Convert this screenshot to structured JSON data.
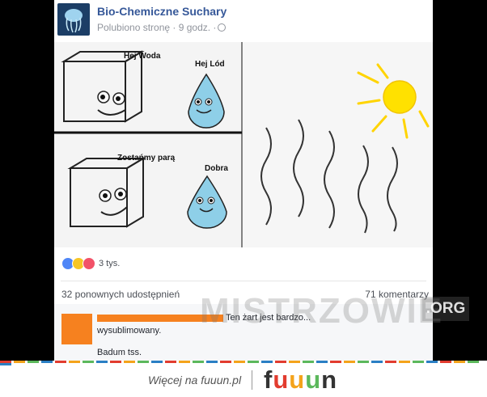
{
  "post": {
    "page_name": "Bio-Chemiczne Suchary",
    "meta": "Polubiono stronę · 9 godz. ·",
    "comic": {
      "panel1_label1": "Hej Woda",
      "panel1_label2": "Hej Lód",
      "panel2_label1": "Zostańmy parą",
      "panel2_label2": "Dobra"
    },
    "reactions": {
      "icons": [
        "like-icon",
        "haha-icon",
        "love-icon"
      ],
      "count": "3 tys."
    },
    "shares": "32 ponownych udostępnień",
    "comments_count": "71 komentarzy",
    "comment": {
      "text_line1": "Ten żart jest bardzo...",
      "text_line2": "wysublimowany.",
      "text_line3": "Badum tss."
    }
  },
  "watermark": {
    "text": "MISTRZOWIE",
    "suffix": ".ORG"
  },
  "footer": {
    "text": "Więcej na fuuun.pl",
    "logo": [
      "f",
      "u",
      "u",
      "u",
      "n"
    ],
    "logo_colors": [
      "#333333",
      "#e23c2f",
      "#f4a31b",
      "#5cb85c",
      "#333333"
    ]
  },
  "colors": {
    "link_blue": "#365899",
    "censor_orange": "#f6811f",
    "sun_yellow": "#ffe100"
  }
}
